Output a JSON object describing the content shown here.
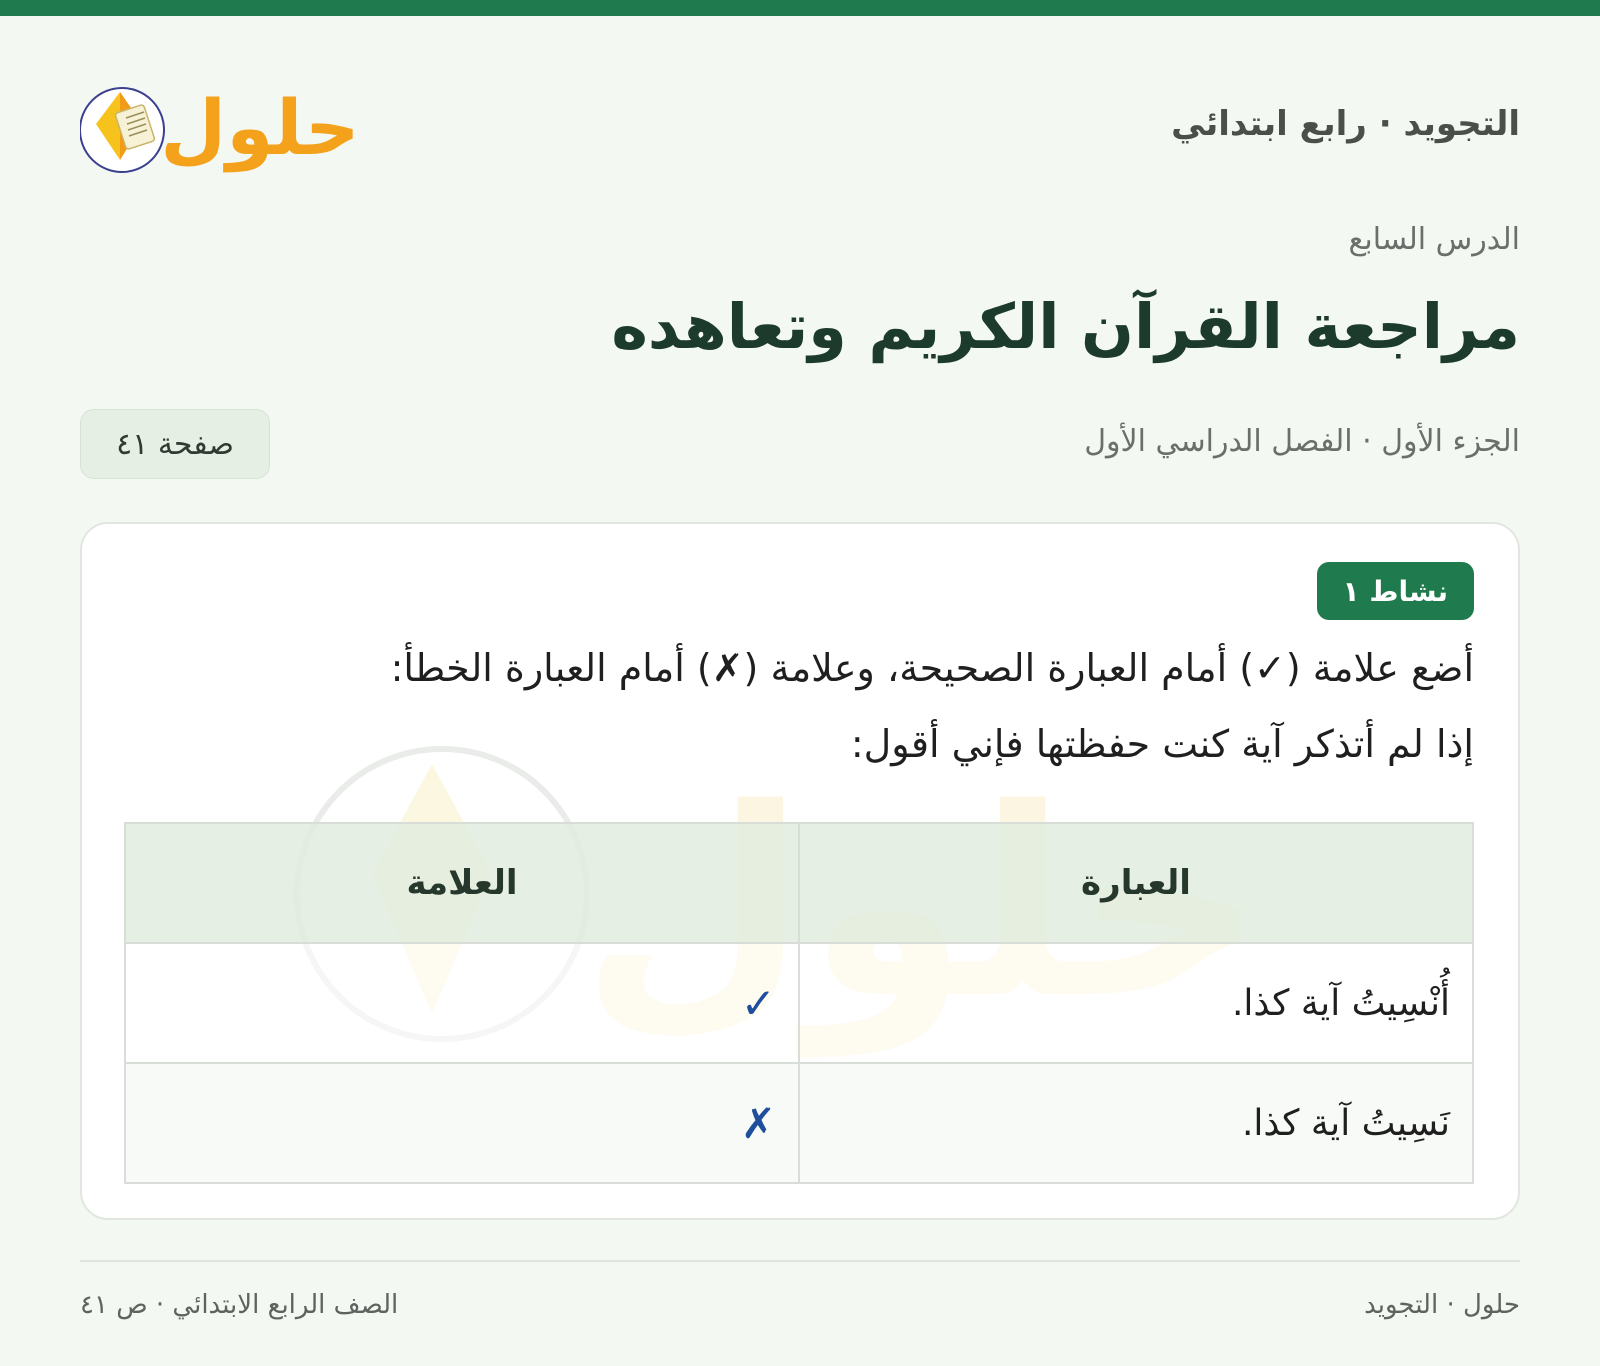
{
  "header": {
    "subject_title": "التجويد · رابع ابتدائي",
    "logo_text": "حلول"
  },
  "lesson": {
    "number_label": "الدرس السابع",
    "title": "مراجعة القرآن الكريم وتعاهده",
    "meta": "الجزء الأول · الفصل الدراسي الأول",
    "page_badge": "صفحة ٤١"
  },
  "activity": {
    "badge": "نشاط ١",
    "instruction_line1": "أضع علامة (✓) أمام العبارة الصحيحة، وعلامة (✗) أمام العبارة الخطأ:",
    "instruction_line2": "إذا لم أتذكر آية كنت حفظتها فإني أقول:",
    "table": {
      "headers": [
        "العبارة",
        "العلامة"
      ],
      "rows": [
        {
          "statement": "أُنْسِيتُ آية كذا.",
          "mark": "✓"
        },
        {
          "statement": "نَسِيتُ آية كذا.",
          "mark": "✗"
        }
      ]
    }
  },
  "footer": {
    "right": "حلول · التجويد",
    "left": "الصف الرابع الابتدائي · ص ٤١"
  },
  "colors": {
    "brand_green": "#1f7a4d",
    "mark_blue": "#1f4f9c",
    "logo_orange": "#f4a21c"
  }
}
